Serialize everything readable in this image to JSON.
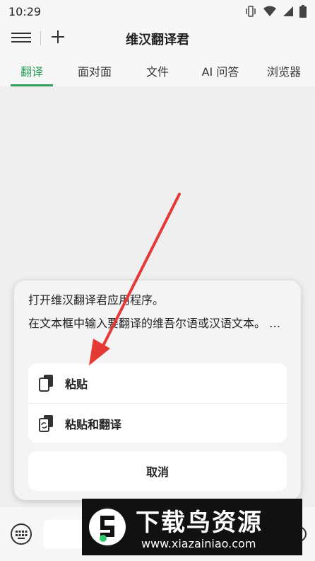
{
  "status": {
    "time": "10:29"
  },
  "toolbar": {
    "title": "维汉翻译君"
  },
  "tabs": [
    {
      "label": "翻译"
    },
    {
      "label": "面对面"
    },
    {
      "label": "文件"
    },
    {
      "label": "AI 问答"
    },
    {
      "label": "浏览器"
    }
  ],
  "sheet": {
    "line1": "打开维汉翻译君应用程序。",
    "line2": "在文本框中输入要翻译的维吾尔语或汉语文本。 …",
    "options": [
      {
        "label": "粘贴",
        "icon": "paste-icon"
      },
      {
        "label": "粘贴和翻译",
        "icon": "paste-translate-icon"
      }
    ],
    "cancel": "取消"
  },
  "watermark": {
    "title": "下载鸟资源",
    "url": "www.xiazainiao.com"
  },
  "colors": {
    "accent": "#2e9e5c",
    "arrow": "#e53935"
  }
}
